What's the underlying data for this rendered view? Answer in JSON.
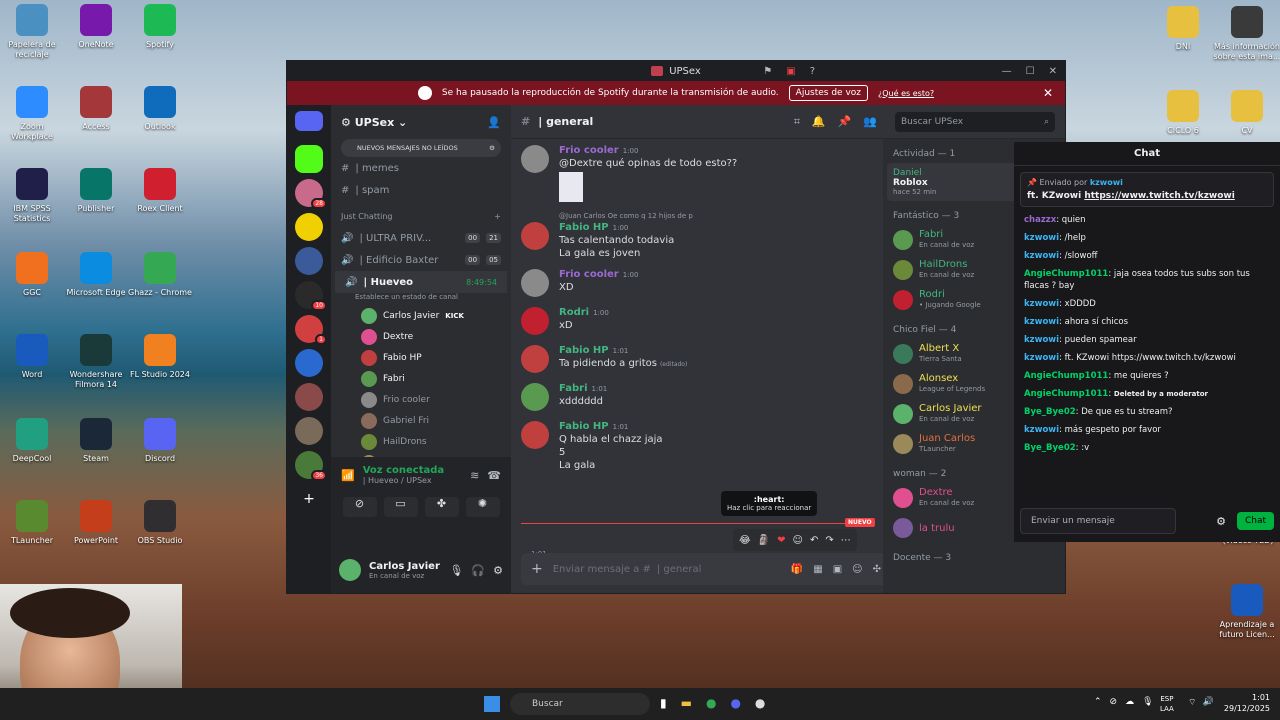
{
  "desktop_left": [
    {
      "label": "Papelera de reciclaje",
      "icon": "recycle-bin-icon",
      "color": "#4a90c0"
    },
    {
      "label": "OneNote",
      "icon": "onenote-icon",
      "color": "#7719aa"
    },
    {
      "label": "Spotify",
      "icon": "spotify-icon",
      "color": "#1db954"
    },
    {
      "label": "Zoom Workplace",
      "icon": "zoom-icon",
      "color": "#2d8cff"
    },
    {
      "label": "Access",
      "icon": "access-icon",
      "color": "#a4373a"
    },
    {
      "label": "Outlook",
      "icon": "outlook-icon",
      "color": "#0f6cbd"
    },
    {
      "label": "IBM SPSS Statistics",
      "icon": "spss-icon",
      "color": "#1f1f4a"
    },
    {
      "label": "Publisher",
      "icon": "publisher-icon",
      "color": "#077568"
    },
    {
      "label": "Roex Client",
      "icon": "roex-icon",
      "color": "#d02030"
    },
    {
      "label": "GGC",
      "icon": "ggc-icon",
      "color": "#f07020"
    },
    {
      "label": "Microsoft Edge",
      "icon": "edge-icon",
      "color": "#0c8ce0"
    },
    {
      "label": "Ghazz - Chrome",
      "icon": "chrome-icon",
      "color": "#34a853"
    },
    {
      "label": "Word",
      "icon": "word-icon",
      "color": "#185abd"
    },
    {
      "label": "Wondershare Filmora 14",
      "icon": "filmora-icon",
      "color": "#1a3a3a"
    },
    {
      "label": "FL Studio 2024",
      "icon": "flstudio-icon",
      "color": "#f08020"
    },
    {
      "label": "DeepCool",
      "icon": "deepcool-icon",
      "color": "#20a080"
    },
    {
      "label": "Steam",
      "icon": "steam-icon",
      "color": "#1b2838"
    },
    {
      "label": "Discord",
      "icon": "discord-icon",
      "color": "#5865f2"
    },
    {
      "label": "TLauncher",
      "icon": "tlauncher-icon",
      "color": "#5a8a30"
    },
    {
      "label": "PowerPoint",
      "icon": "powerpoint-icon",
      "color": "#c43e1c"
    },
    {
      "label": "OBS Studio",
      "icon": "obs-icon",
      "color": "#302e31"
    }
  ],
  "desktop_right": [
    {
      "label": "DNI",
      "icon": "folder-icon",
      "color": "#e8c040"
    },
    {
      "label": "Más información sobre esta ima...",
      "icon": "info-icon",
      "color": "#3a3a3a"
    },
    {
      "label": "CICLO 6",
      "icon": "folder-icon",
      "color": "#e8c040"
    },
    {
      "label": "CV",
      "icon": "folder-icon",
      "color": "#e8c040"
    },
    {
      "label": "Aprendizaje a futuro Licen...",
      "icon": "word-doc-icon",
      "color": "#185abd"
    }
  ],
  "partial_label": "(videos TED)",
  "discord": {
    "title": "UPSex",
    "banner_text": "Se ha pausado la reproducción de Spotify durante la transmisión de audio.",
    "banner_button": "Ajustes de voz",
    "banner_link": "¿Qué es esto?",
    "server_name": "UPSex",
    "new_messages": "NUEVOS MENSAJES NO LEÍDOS",
    "text_channels": [
      {
        "name": "| memes"
      },
      {
        "name": "| spam"
      }
    ],
    "category": "Just Chatting",
    "voice_channels": [
      {
        "name": "| ULTRA PRIV...",
        "a": "00",
        "b": "21"
      },
      {
        "name": "| Edificio Baxter",
        "a": "00",
        "b": "05"
      }
    ],
    "active_voice": {
      "name": "| Hueveo",
      "timer": "8:49:54",
      "status": "Establece un estado de canal"
    },
    "voice_users": [
      {
        "name": "Carlos Javier",
        "badge": "KICK",
        "color": "#5bb36b"
      },
      {
        "name": "Dextre",
        "badge": "",
        "color": "#e05090"
      },
      {
        "name": "Fabio HP",
        "badge": "",
        "color": "#c04040"
      },
      {
        "name": "Fabri",
        "badge": "",
        "color": "#5a9a50"
      },
      {
        "name": "Frio cooler",
        "badge": "",
        "color": "#8a8a8a"
      },
      {
        "name": "Gabriel Fri",
        "badge": "",
        "color": "#8a6a5a"
      },
      {
        "name": "HailDrons",
        "badge": "",
        "color": "#6a8a3a"
      },
      {
        "name": "Juan Carlos",
        "badge": "",
        "color": "#9a8a5a"
      }
    ],
    "voice_connected": "Voz conectada",
    "voice_location": "| Hueveo / UPSex",
    "user_name": "Carlos Javier",
    "user_status": "En canal de voz",
    "channel_header": "| general",
    "search_placeholder": "Buscar UPSex",
    "messages": [
      {
        "name": "Frio cooler",
        "time": "1:00",
        "color": "#9a6ad0",
        "text": "@Dextre qué opinas de todo esto??",
        "pic": "#8a8a8a"
      },
      {
        "name": "Fabio HP",
        "time": "1:00",
        "color": "#43b581",
        "text": "Tas calentando todavia",
        "text2": "La gala es joven",
        "reply": "@Juan Carlos Oe como q 12 hijos de p",
        "pic": "#c04040"
      },
      {
        "name": "Frio cooler",
        "time": "1:00",
        "color": "#9a6ad0",
        "text": "XD",
        "pic": "#8a8a8a"
      },
      {
        "name": "Rodri",
        "time": "1:00",
        "color": "#43b581",
        "text": "xD",
        "pic": "#c02030"
      },
      {
        "name": "Fabio HP",
        "time": "1:01",
        "color": "#43b581",
        "text": "Ta pidiendo a gritos",
        "edited": "(editado)",
        "pic": "#c04040"
      },
      {
        "name": "Fabri",
        "time": "1:01",
        "color": "#43b581",
        "text": "xdddddd",
        "pic": "#5a9a50"
      },
      {
        "name": "Fabio HP",
        "time": "1:01",
        "color": "#43b581",
        "text": "Q habla el chazz jaja",
        "text2": "5",
        "text3": "La gala",
        "pic": "#c04040"
      }
    ],
    "new_label": "NUEVO",
    "tooltip_title": ":heart:",
    "tooltip_sub": "Haz clic para reaccionar",
    "msg_time_side": "1:01",
    "composer_placeholder": "Enviar mensaje a #",
    "composer_channel": "| general",
    "members": {
      "activity_header": "Actividad — 1",
      "activity_user": "Daniel",
      "activity_game": "Roblox",
      "activity_time": "hace 52 min",
      "groups": [
        {
          "header": "Fantástico — 3",
          "items": [
            {
              "name": "Fabri",
              "status": "En canal de voz",
              "color": "#43b581",
              "pic": "#5a9a50"
            },
            {
              "name": "HailDrons",
              "status": "En canal de voz",
              "color": "#43b581",
              "pic": "#6a8a3a"
            },
            {
              "name": "Rodri",
              "status": "• Jugando Google",
              "color": "#43b581",
              "pic": "#c02030"
            }
          ]
        },
        {
          "header": "Chico Fiel — 4",
          "items": [
            {
              "name": "Albert X",
              "status": "Tierra Santa",
              "color": "#f0e050",
              "pic": "#3a7a5a"
            },
            {
              "name": "Alonsex",
              "status": "League of Legends",
              "color": "#f0e050",
              "pic": "#8a6a4a"
            },
            {
              "name": "Carlos Javier",
              "status": "En canal de voz",
              "color": "#f0e050",
              "pic": "#5bb36b"
            },
            {
              "name": "Juan Carlos",
              "status": "TLauncher",
              "color": "#e07040",
              "pic": "#9a8a5a"
            }
          ]
        },
        {
          "header": "woman — 2",
          "items": [
            {
              "name": "Dextre",
              "status": "En canal de voz",
              "color": "#e05090",
              "pic": "#e05090"
            },
            {
              "name": "la trulu",
              "status": "",
              "color": "#e05090",
              "pic": "#7a5a9a"
            }
          ]
        }
      ],
      "last_header": "Docente — 3"
    }
  },
  "twitch_chat": {
    "title": "Chat",
    "pinned_by": "Enviado por",
    "pinned_user": "kzwowi",
    "pinned_text": "ft. KZwowi ",
    "pinned_link": "https://www.twitch.tv/kzwowi",
    "lines": [
      {
        "user": "chazzx",
        "text": "quien",
        "color": "#9a6ad0"
      },
      {
        "user": "kzwowi",
        "text": "/help",
        "color": "#3ab4f2"
      },
      {
        "user": "kzwowi",
        "text": "/slowoff",
        "color": "#3ab4f2"
      },
      {
        "user": "AngieChump1011",
        "text": "jaja osea todos tus subs son tus flacas ? bay",
        "color": "#00d26a"
      },
      {
        "user": "kzwowi",
        "text": "xDDDD",
        "color": "#3ab4f2"
      },
      {
        "user": "kzwowi",
        "text": "ahora sí chicos",
        "color": "#3ab4f2"
      },
      {
        "user": "kzwowi",
        "text": "pueden spamear",
        "color": "#3ab4f2"
      },
      {
        "user": "kzwowi",
        "text": "ft. KZwowi https://www.twitch.tv/kzwowi",
        "color": "#3ab4f2"
      },
      {
        "user": "AngieChump1011",
        "text": "me quieres ?",
        "color": "#00d26a"
      },
      {
        "user": "AngieChump1011",
        "text": "Deleted by a moderator",
        "color": "#00d26a"
      },
      {
        "user": "Bye_Bye02",
        "text": "De que es tu stream?",
        "color": "#00d26a"
      },
      {
        "user": "kzwowi",
        "text": "más gespeto por favor",
        "color": "#3ab4f2"
      },
      {
        "user": "Bye_Bye02",
        "text": ":v",
        "color": "#00d26a"
      }
    ],
    "input_placeholder": "Enviar un mensaje",
    "send_label": "Chat"
  },
  "taskbar": {
    "search": "Buscar",
    "lang1": "ESP",
    "lang2": "LAA",
    "time": "1:01",
    "date": "29/12/2025"
  }
}
